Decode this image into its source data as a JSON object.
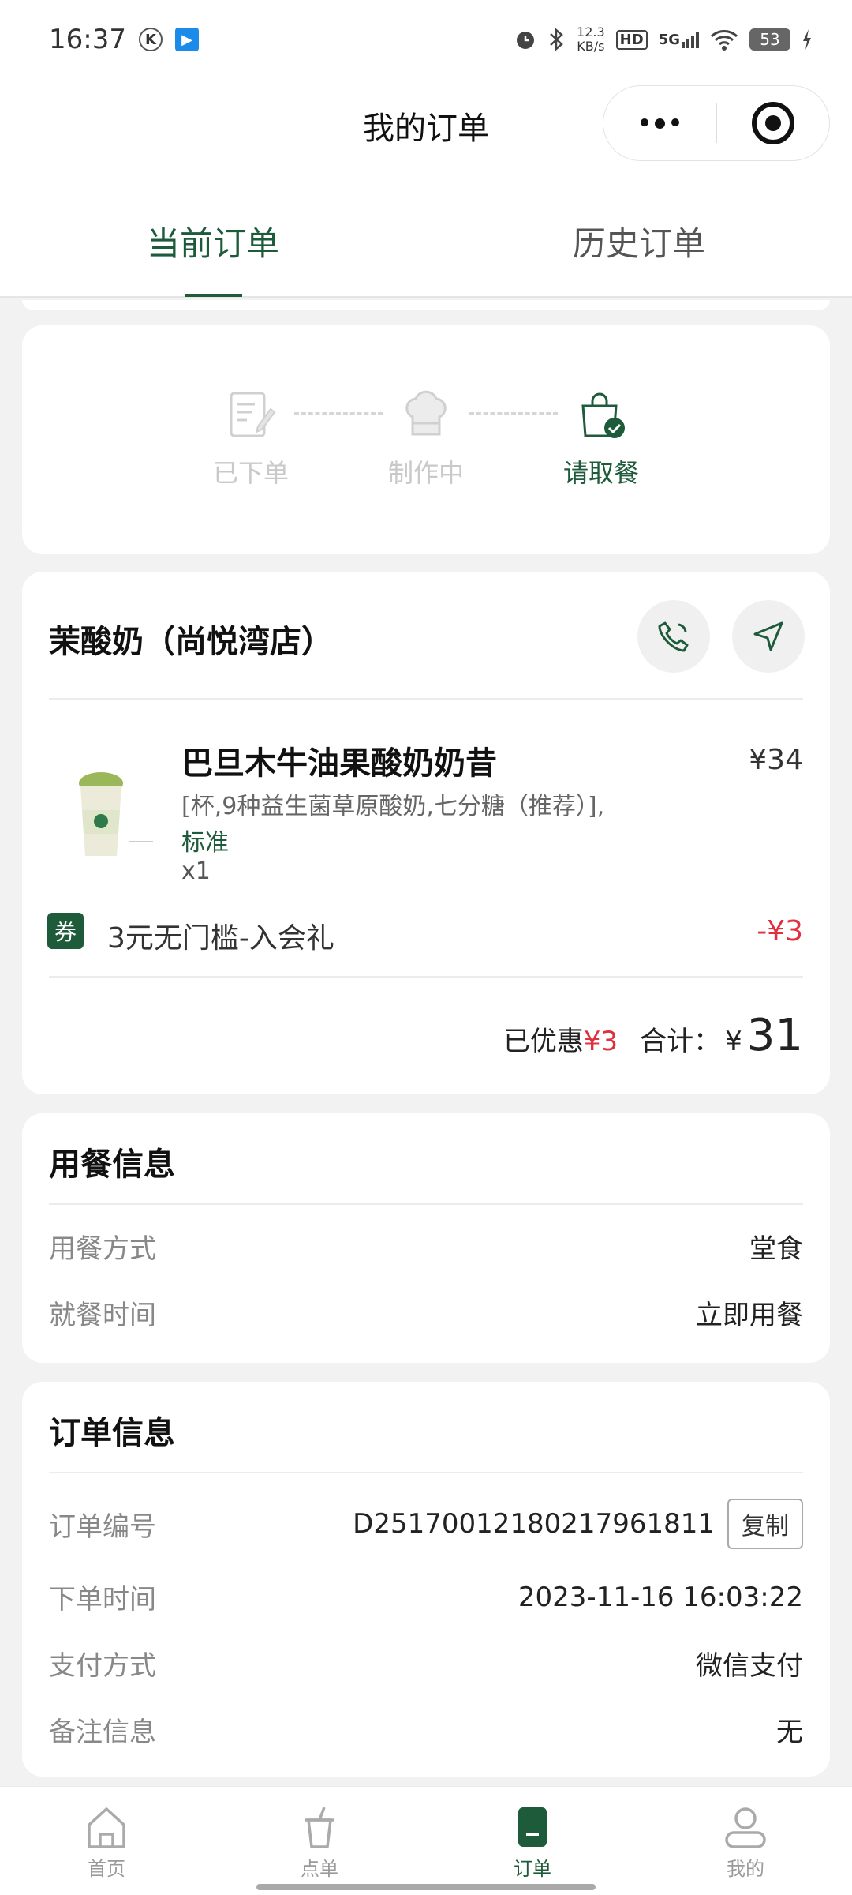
{
  "status": {
    "time": "16:37",
    "k_badge": "K",
    "blue_badge": "▶",
    "speed_top": "12.3",
    "speed_bottom": "KB/s",
    "hd": "HD",
    "net": "5G",
    "battery": "53"
  },
  "header": {
    "title": "我的订单"
  },
  "tabs": [
    {
      "label": "当前订单",
      "active": true
    },
    {
      "label": "历史订单",
      "active": false
    }
  ],
  "progress": {
    "steps": [
      {
        "label": "已下单"
      },
      {
        "label": "制作中"
      },
      {
        "label": "请取餐"
      }
    ],
    "current": 2
  },
  "store": {
    "name": "茉酸奶（尚悦湾店）",
    "item": {
      "name": "巴旦木牛油果酸奶奶昔",
      "price": "¥34",
      "spec": "[杯,9种益生菌草原酸奶,七分糖（推荐）],",
      "spec2": "标准",
      "qty": "x1"
    },
    "coupon": {
      "icon": "券",
      "text": "3元无门槛-入会礼",
      "value": "-¥3"
    },
    "summary": {
      "discount_label": "已优惠",
      "discount": "¥3",
      "total_label": "合计：",
      "currency": "¥",
      "total": "31"
    }
  },
  "dining": {
    "title": "用餐信息",
    "rows": [
      {
        "k": "用餐方式",
        "v": "堂食"
      },
      {
        "k": "就餐时间",
        "v": "立即用餐"
      }
    ]
  },
  "order": {
    "title": "订单信息",
    "number_label": "订单编号",
    "number": "D25170012180217961811",
    "copy_label": "复制",
    "rows": [
      {
        "k": "下单时间",
        "v": "2023-11-16 16:03:22"
      },
      {
        "k": "支付方式",
        "v": "微信支付"
      },
      {
        "k": "备注信息",
        "v": "无"
      }
    ]
  },
  "tabbar": [
    {
      "label": "首页",
      "icon": "home-icon"
    },
    {
      "label": "点单",
      "icon": "cup-icon"
    },
    {
      "label": "订单",
      "icon": "order-icon",
      "active": true
    },
    {
      "label": "我的",
      "icon": "profile-icon"
    }
  ],
  "colors": {
    "brand": "#1d5b3a",
    "price_red": "#e0303d"
  }
}
